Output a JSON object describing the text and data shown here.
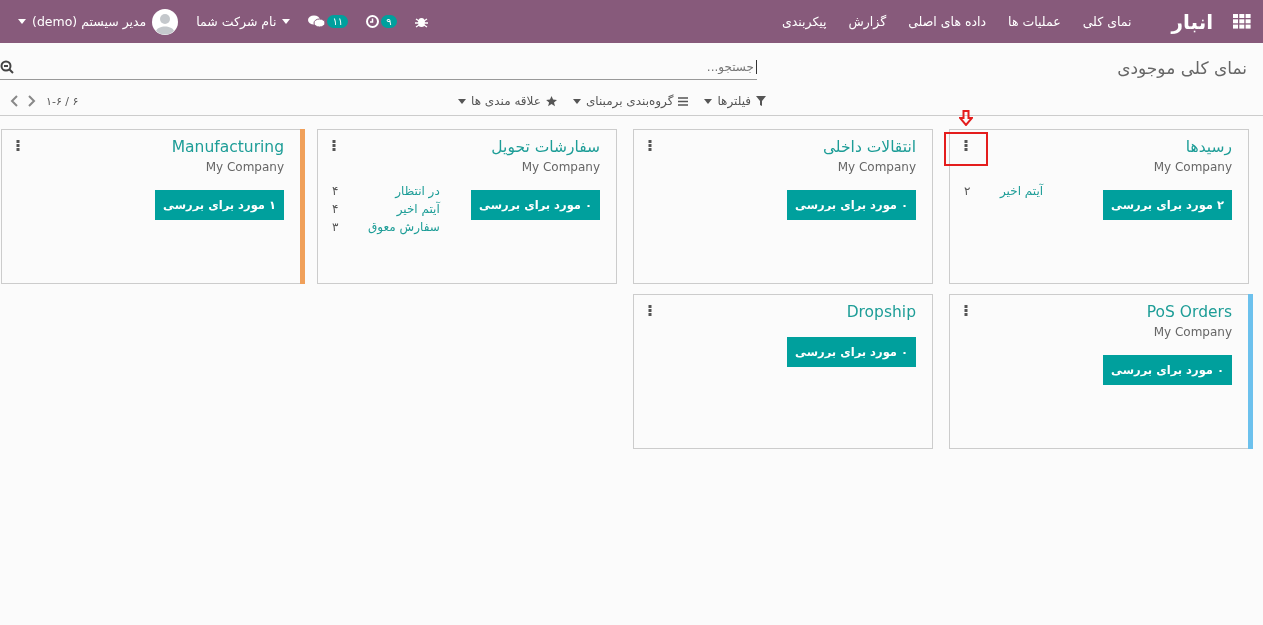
{
  "navbar": {
    "app_name": "انبار",
    "menu": [
      "نمای کلی",
      "عملیات ها",
      "داده های اصلی",
      "گزارش",
      "پیکربندی"
    ],
    "activities_count": "۹",
    "messages_count": "۱۱",
    "company": "نام شرکت شما",
    "user": "مدیر سیستم (demo)"
  },
  "control_panel": {
    "breadcrumb": "نمای کلی موجودی",
    "search": {
      "placeholder": "جستجو..."
    },
    "filters": "فیلترها",
    "group_by": "گروه‌بندی برمبنای",
    "favorites": "علاقه مندی ها",
    "pager": "۱-۶ / ۶"
  },
  "cards": [
    {
      "title": "رسیدها",
      "company": "My Company",
      "button": "۲ مورد برای بررسی",
      "stats": [
        {
          "label": "آیتم اخیر",
          "count": "۲"
        }
      ],
      "annotated": true
    },
    {
      "title": "انتقالات داخلی",
      "company": "My Company",
      "button": "۰ مورد برای بررسی",
      "annotated": false
    },
    {
      "title": "سفارشات تحویل",
      "company": "My Company",
      "button": "۰ مورد برای بررسی",
      "stats": [
        {
          "label": "در انتظار",
          "count": "۴"
        },
        {
          "label": "آیتم اخیر",
          "count": "۴"
        },
        {
          "label": "سفارش معوق",
          "count": "۳"
        }
      ],
      "annotated": false
    },
    {
      "title": "Manufacturing",
      "company": "My Company",
      "button": "۱ مورد برای بررسی",
      "color": "#f0a05a",
      "annotated": false
    },
    {
      "title": "PoS Orders",
      "company": "My Company",
      "button": "۰ مورد برای بررسی",
      "color": "#6cc1ed",
      "annotated": false
    },
    {
      "title": "Dropship",
      "button": "۰ مورد برای بررسی",
      "annotated": false
    }
  ]
}
